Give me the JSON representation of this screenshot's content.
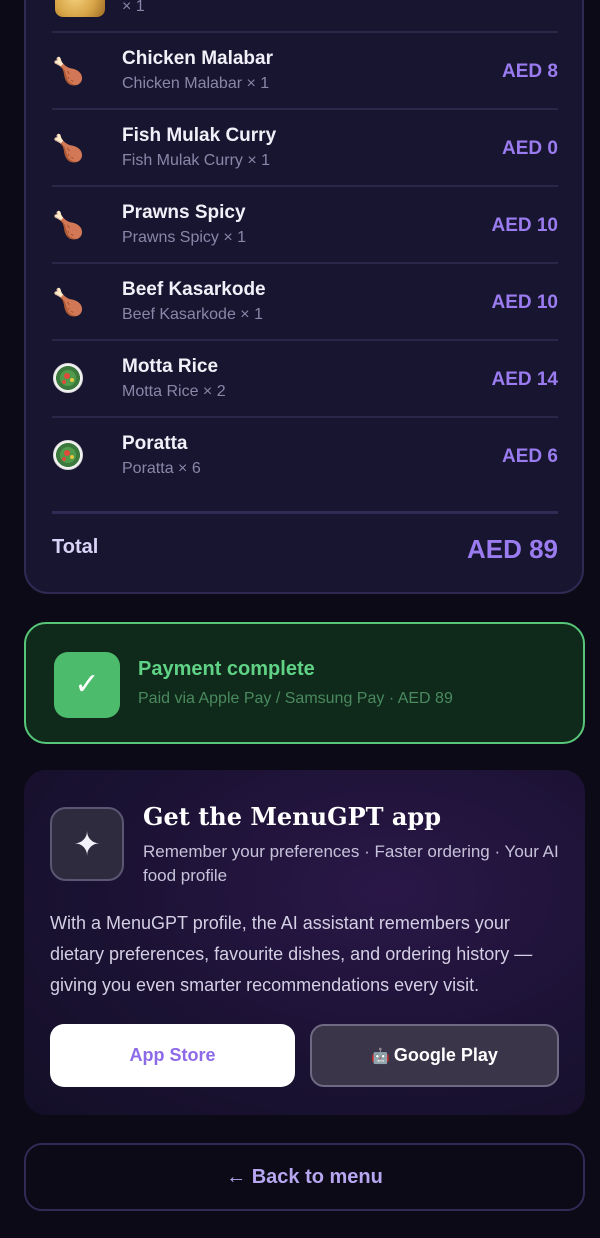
{
  "order": {
    "partial_item": {
      "sub": "× 1"
    },
    "items": [
      {
        "icon": "drumstick-icon",
        "name": "Chicken Malabar",
        "sub": "Chicken Malabar × 1",
        "price": "AED 8"
      },
      {
        "icon": "drumstick-icon",
        "name": "Fish Mulak Curry",
        "sub": "Fish Mulak Curry × 1",
        "price": "AED 0"
      },
      {
        "icon": "drumstick-icon",
        "name": "Prawns Spicy",
        "sub": "Prawns Spicy × 1",
        "price": "AED 10"
      },
      {
        "icon": "drumstick-icon",
        "name": "Beef Kasarkode",
        "sub": "Beef Kasarkode × 1",
        "price": "AED 10"
      },
      {
        "icon": "salad-icon",
        "name": "Motta Rice",
        "sub": "Motta Rice × 2",
        "price": "AED 14"
      },
      {
        "icon": "salad-icon",
        "name": "Poratta",
        "sub": "Poratta × 6",
        "price": "AED 6"
      }
    ],
    "total_label": "Total",
    "total_value": "AED 89"
  },
  "payment": {
    "check_glyph": "✓",
    "title": "Payment complete",
    "subtitle": "Paid via Apple Pay / Samsung Pay · AED 89"
  },
  "app_promo": {
    "sparkle_glyph": "✦",
    "title": "Get the MenuGPT app",
    "subtitle": "Remember your preferences · Faster ordering · Your AI food profile",
    "description": "With a MenuGPT profile, the AI assistant remembers your dietary preferences, favourite dishes, and ordering history — giving you even smarter recommendations every visit.",
    "app_store_label": "App Store",
    "google_play_icon": "🤖",
    "google_play_label": "Google Play"
  },
  "back_button": {
    "label": "← Back to menu"
  },
  "colors": {
    "accent": "#9a7cf0",
    "success": "#57c679",
    "background": "#0c0a16"
  }
}
